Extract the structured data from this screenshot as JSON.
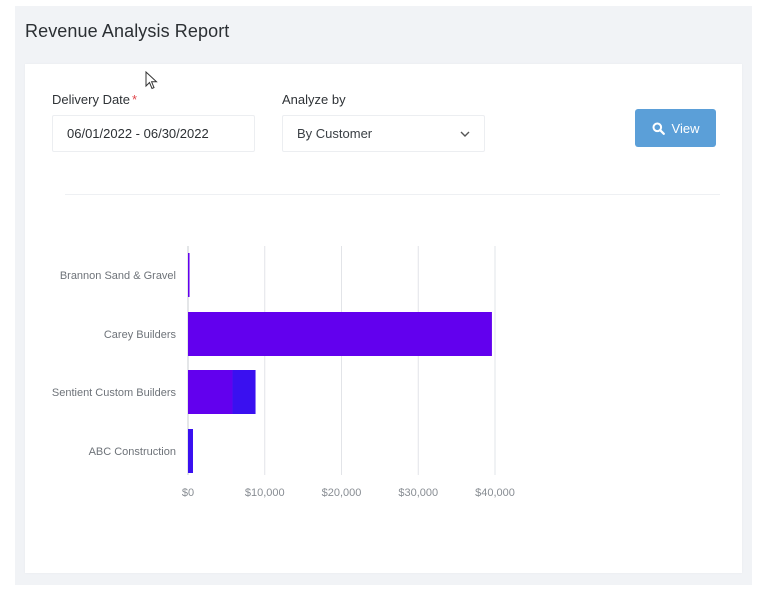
{
  "page": {
    "title": "Revenue Analysis Report"
  },
  "filters": {
    "delivery_date_label": "Delivery Date",
    "required_marker": "*",
    "delivery_date_value": "06/01/2022 - 06/30/2022",
    "analyze_by_label": "Analyze by",
    "analyze_by_value": "By Customer",
    "view_label": "View"
  },
  "colors": {
    "accent_button": "#5b9fd8",
    "required": "#e0464b",
    "bar_primary": "#6200ee",
    "bar_secondary": "#3a10f0"
  },
  "icons": {
    "view_button": "search-icon",
    "select_toggle": "chevron-down-icon",
    "pointer": "mouse-cursor-icon"
  },
  "chart_data": {
    "type": "bar",
    "orientation": "horizontal",
    "stacked": true,
    "categories": [
      "Brannon Sand & Gravel",
      "Carey Builders",
      "Sentient Custom Builders",
      "ABC Construction"
    ],
    "series": [
      {
        "values": [
          200,
          39600,
          5800,
          0
        ],
        "color": "#6200ee"
      },
      {
        "values": [
          0,
          0,
          3000,
          650
        ],
        "color": "#3a10f0"
      }
    ],
    "xticks": [
      "$0",
      "$10,000",
      "$20,000",
      "$30,000",
      "$40,000"
    ],
    "xlim": [
      0,
      40000
    ],
    "grid": true,
    "legend": "none"
  }
}
